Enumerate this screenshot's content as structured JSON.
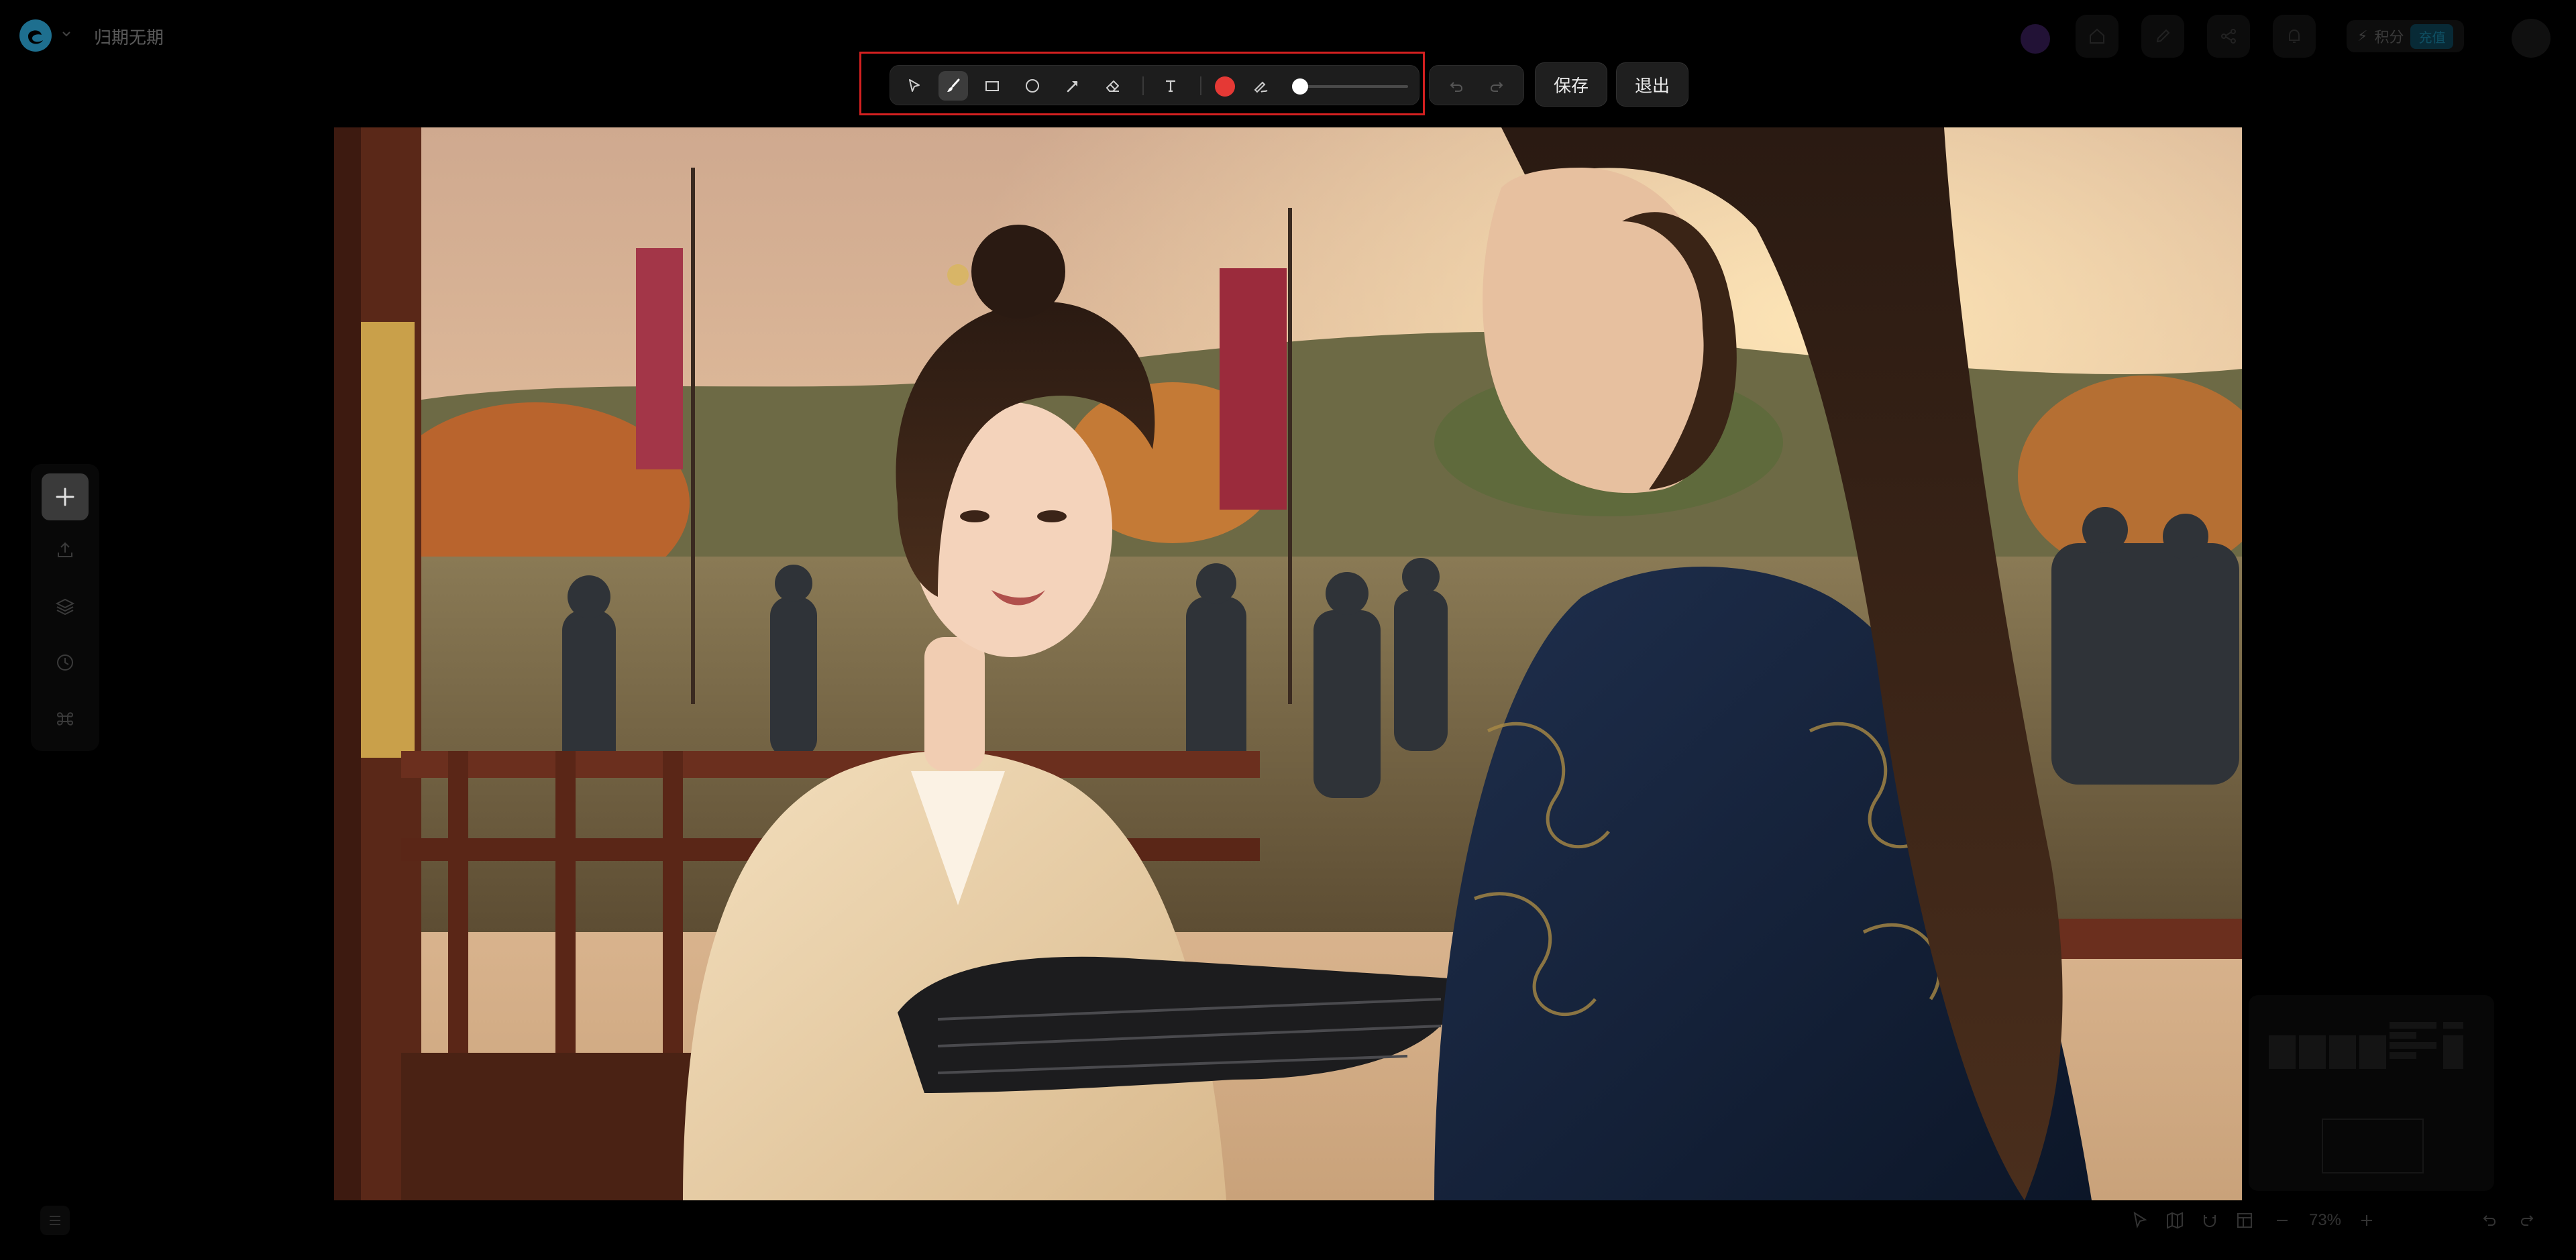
{
  "app": {
    "project_title": "归期无期"
  },
  "toolbar": {
    "tools": [
      {
        "name": "select",
        "icon": "cursor-icon",
        "active": false
      },
      {
        "name": "brush",
        "icon": "brush-icon",
        "active": true
      },
      {
        "name": "rectangle",
        "icon": "rectangle-icon",
        "active": false
      },
      {
        "name": "ellipse",
        "icon": "circle-icon",
        "active": false
      },
      {
        "name": "arrow",
        "icon": "arrow-icon",
        "active": false
      },
      {
        "name": "eraser",
        "icon": "eraser-icon",
        "active": false
      },
      {
        "name": "text",
        "icon": "text-icon",
        "active": false
      }
    ],
    "color": "#e53935",
    "stroke_size_fraction": 0.05,
    "save_label": "保存",
    "exit_label": "退出"
  },
  "header_right": {
    "credits_label": "积分",
    "credits_badge": "充值"
  },
  "status_bar": {
    "zoom": "73%"
  },
  "colors": {
    "background": "#000000",
    "highlight_box": "#d42020",
    "active_color": "#e53935"
  }
}
